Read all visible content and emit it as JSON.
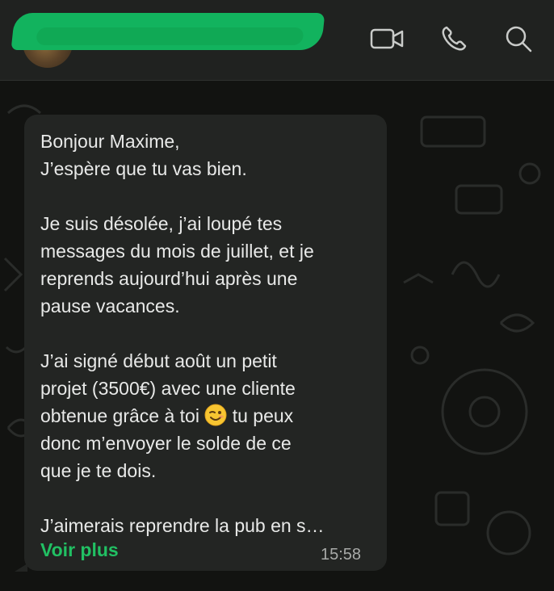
{
  "header": {
    "contact_name": "",
    "icons": [
      "video-camera-icon",
      "phone-icon",
      "search-icon"
    ]
  },
  "message": {
    "lines": [
      "Bonjour Maxime,",
      "J’espère que tu vas bien.",
      "",
      "Je suis désolée, j’ai loupé tes",
      "messages du mois de juillet, et je",
      "reprends aujourd’hui après une",
      "pause vacances.",
      "",
      "J’ai signé début août un petit",
      "projet (3500€) avec une cliente",
      "obtenue grâce à toi",
      "donc m’envoyer le solde de ce",
      "que je te dois.",
      "",
      "J’aimerais reprendre la pub en s…"
    ],
    "emoji_after_line_11": "winking-face-emoji",
    "line_11_suffix": " tu peux",
    "read_more": "Voir plus",
    "time": "15:58"
  },
  "colors": {
    "accent": "#21c063",
    "bubble": "#232523",
    "header": "#202220",
    "text": "#e8e9e8"
  }
}
